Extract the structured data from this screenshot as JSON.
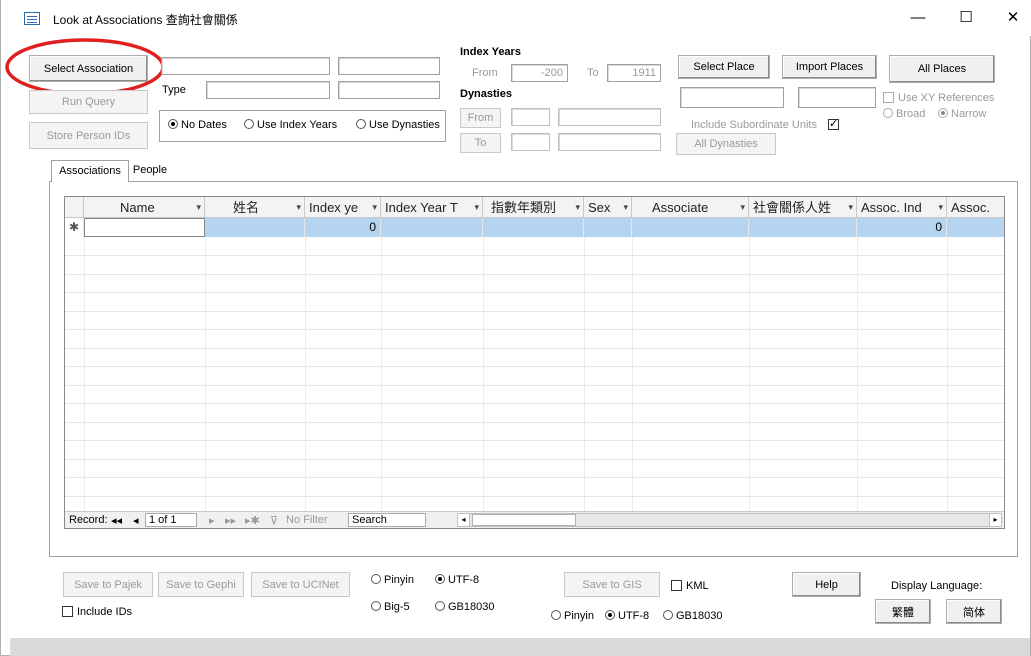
{
  "window": {
    "title": "Look at Associations 查詢社會關係",
    "minimize": "—",
    "maximize": "☐",
    "close": "✕"
  },
  "top": {
    "select_association": "Select Association",
    "run_query": "Run Query",
    "store_person_ids": "Store Person IDs",
    "type_label": "Type",
    "date_options": [
      "No Dates",
      "Use Index Years",
      "Use Dynasties"
    ],
    "date_selected": "No Dates",
    "index_years_label": "Index Years",
    "from_label": "From",
    "from_value": "-200",
    "to_label": "To",
    "to_value": "1911",
    "dynasties_label": "Dynasties",
    "dyn_from": "From",
    "dyn_to": "To",
    "select_place": "Select Place",
    "import_places": "Import Places",
    "all_places": "All Places",
    "use_xy": "Use XY References",
    "broad": "Broad",
    "narrow": "Narrow",
    "include_subordinate": "Include Subordinate Units",
    "all_dynasties": "All Dynasties"
  },
  "tabs": [
    "Associations",
    "People"
  ],
  "grid": {
    "columns": [
      "Name",
      "姓名",
      "Index ye",
      "Index Year T",
      "指數年類別",
      "Sex",
      "Associate",
      "社會關係人姓",
      "Assoc. Ind",
      "Assoc."
    ],
    "new_row_marker": "✱",
    "new_row_values": [
      "",
      "",
      "0",
      "",
      "",
      "",
      "",
      "",
      "0",
      ""
    ]
  },
  "navigator": {
    "record_label": "Record:",
    "first": "◂◂",
    "prev": "◂",
    "position": "1 of 1",
    "next": "▸",
    "last": "▸▸",
    "new": "▸✱",
    "filter": "No Filter",
    "search": "Search"
  },
  "bottom": {
    "save_pajek": "Save to Pajek",
    "save_gephi": "Save to Gephi",
    "save_ucinet": "Save to UCINet",
    "include_ids": "Include IDs",
    "enc1": [
      "Pinyin",
      "UTF-8",
      "Big-5",
      "GB18030"
    ],
    "enc1_selected": "UTF-8",
    "save_gis": "Save to GIS",
    "kml": "KML",
    "enc2": [
      "Pinyin",
      "UTF-8",
      "GB18030"
    ],
    "enc2_selected": "UTF-8",
    "help": "Help",
    "display_language": "Display Language:",
    "traditional": "繁體",
    "simplified": "简体"
  },
  "colors": {
    "accent_selection": "#b4d4f0",
    "highlight_circle": "#e02020"
  }
}
